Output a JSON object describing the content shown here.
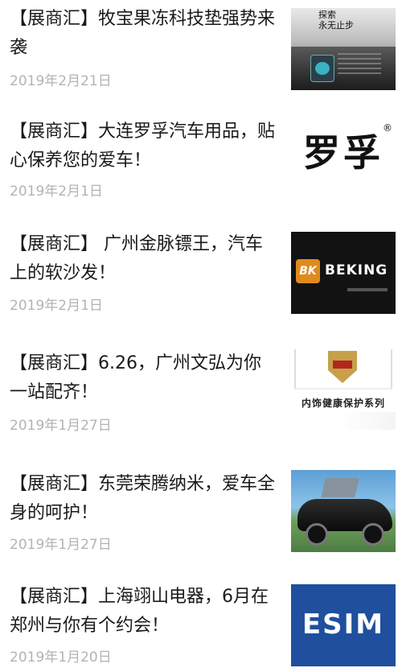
{
  "articles": [
    {
      "title": "【展商汇】牧宝果冻科技垫强势来袭",
      "date": "2019年2月21日",
      "thumb_text": [
        "探索",
        "永无止步"
      ]
    },
    {
      "title": "【展商汇】大连罗孚汽车用品，贴心保养您的爱车！",
      "date": "2019年2月1日",
      "thumb_text": [
        "罗孚",
        "®"
      ]
    },
    {
      "title": "【展商汇】 广州金脉镖王，汽车上的软沙发！",
      "date": "2019年2月1日",
      "thumb_text": [
        "BK",
        "BEKING"
      ]
    },
    {
      "title": "【展商汇】6.26，广州文弘为你一站配齐！",
      "date": "2019年1月27日",
      "thumb_text": [
        "内饰健康保护系列"
      ]
    },
    {
      "title": "【展商汇】东莞荣腾纳米，爱车全身的呵护！",
      "date": "2019年1月27日",
      "thumb_text": []
    },
    {
      "title": "【展商汇】上海翊山电器，6月在郑州与你有个约会！",
      "date": "2019年1月20日",
      "thumb_text": [
        "ESIM"
      ]
    }
  ],
  "colors": {
    "title": "#1a1a1a",
    "date": "#b3b3b3",
    "background": "#ffffff"
  }
}
